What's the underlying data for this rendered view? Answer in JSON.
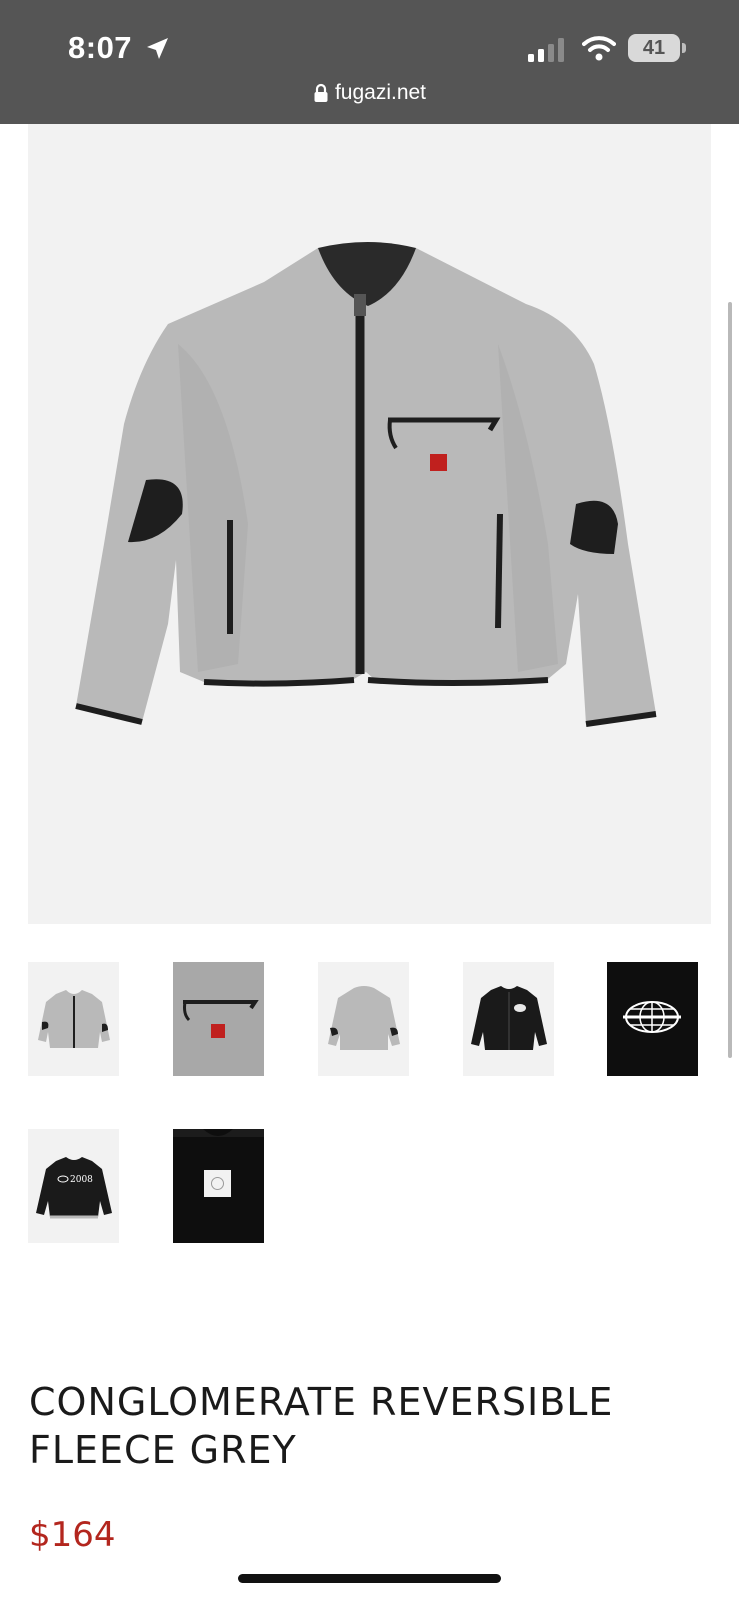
{
  "status_bar": {
    "time": "8:07",
    "battery": "41"
  },
  "browser": {
    "url": "fugazi.net"
  },
  "gallery": {
    "main_image_icon": "fleece-jacket-image",
    "thumbnails": [
      {
        "icon": "grey-fleece-front-thumbnail"
      },
      {
        "icon": "fleece-pocket-detail-thumbnail"
      },
      {
        "icon": "grey-fleece-back-thumbnail"
      },
      {
        "icon": "black-jacket-front-thumbnail"
      },
      {
        "icon": "globe-logo-thumbnail"
      },
      {
        "icon": "black-jacket-2008-thumbnail",
        "text": "2008"
      },
      {
        "icon": "black-jacket-back-patch-thumbnail"
      }
    ]
  },
  "product": {
    "title_line1": "CONGLOMERATE REVERSIBLE",
    "title_line2": "FLEECE GREY",
    "price": "$164"
  },
  "colors": {
    "status_bar_bg": "#555555",
    "image_bg": "#f2f2f2",
    "fleece": "#b8b8b8",
    "trim": "#1e1e1e",
    "patch": "#c0201e",
    "price": "#b3261e"
  }
}
